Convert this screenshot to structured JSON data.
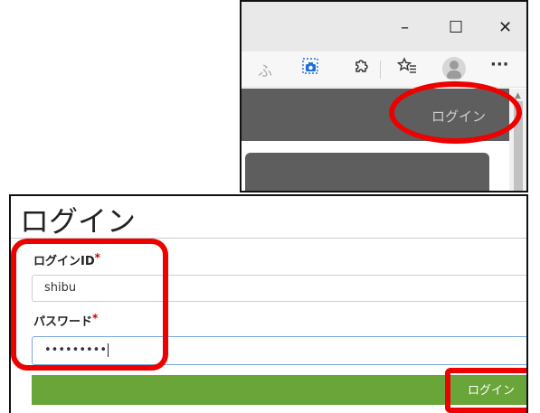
{
  "browser": {
    "window_controls": {
      "minimize": "–",
      "maximize": "☐",
      "close": "✕"
    },
    "toolbar": {
      "fu_label": "ふ",
      "icons": [
        "screenshot-camera-icon",
        "extensions-icon",
        "favorites-icon",
        "profile-icon",
        "more-icon"
      ],
      "more_label": "···"
    },
    "page": {
      "login_link": "ログイン"
    }
  },
  "login_form": {
    "heading": "ログイン",
    "login_id_label": "ログインID",
    "login_id_value": "shibu",
    "password_label": "パスワード",
    "password_value": "•••••••••",
    "required_mark": "*",
    "submit_label": "ログイン"
  },
  "colors": {
    "highlight": "#ee0000",
    "button_green": "#6aa539",
    "header_gray": "#5e5e5e",
    "required_red": "#cc0000"
  }
}
